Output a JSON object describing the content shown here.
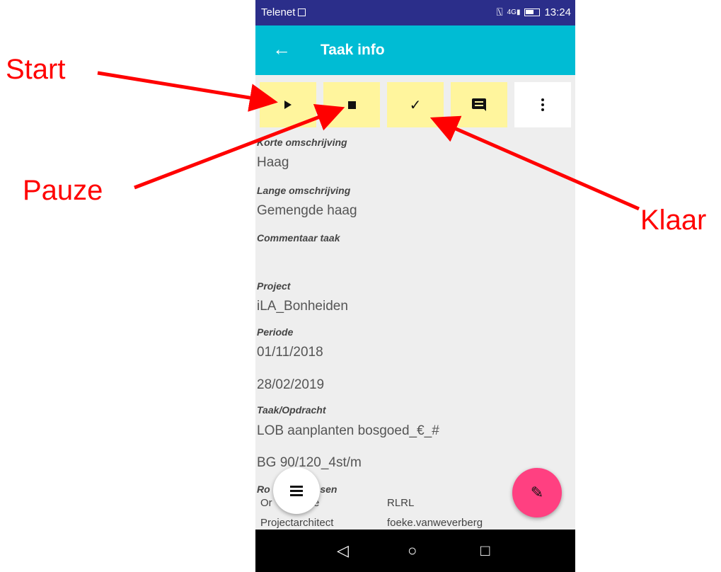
{
  "status_bar": {
    "carrier": "Telenet",
    "network": "4G",
    "time": "13:24"
  },
  "app_bar": {
    "back_icon": "arrow-left-icon",
    "title": "Taak info"
  },
  "actions": [
    {
      "name": "play-icon"
    },
    {
      "name": "stop-icon"
    },
    {
      "name": "check-icon",
      "glyph": "✓"
    },
    {
      "name": "comment-icon"
    },
    {
      "name": "more-vertical-icon"
    }
  ],
  "fields": {
    "korte_label": "Korte omschrijving",
    "korte_value": "Haag",
    "lange_label": "Lange omschrijving",
    "lange_value": "Gemengde haag",
    "commentaar_label": "Commentaar taak",
    "project_label": "Project",
    "project_value": "iLA_Bonheiden",
    "periode_label": "Periode",
    "periode_start": "01/11/2018",
    "periode_end": "28/02/2019",
    "taak_label": "Taak/Opdracht",
    "taak_value": "LOB aanplanten bosgoed_€_#",
    "taak_value2": "BG 90/120_4st/m",
    "rollen_label_start": "Ro",
    "rollen_label_end": "ensen"
  },
  "roles_table": [
    {
      "role": "Or",
      "role_end": "e",
      "person": "RLRL"
    },
    {
      "role": "Projectarchitect",
      "person": "foeke.vanweverberg"
    }
  ],
  "nav": {
    "back": "◁",
    "home": "○",
    "recent": "□"
  },
  "annotations": {
    "start": "Start",
    "pauze": "Pauze",
    "klaar": "Klaar"
  },
  "colors": {
    "status_bar": "#2b2e8a",
    "app_bar": "#00bcd4",
    "action_button": "#fff59d",
    "fab_edit": "#ff4081",
    "annotation": "#ff0000"
  }
}
